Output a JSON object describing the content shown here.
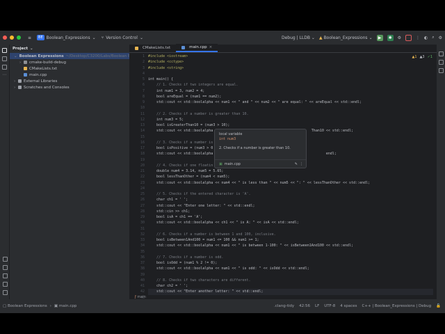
{
  "titlebar": {
    "project_badge": "BE",
    "project_name": "Boolean_Expressions",
    "vcs": "Version Control",
    "config": "Debug | LLDB",
    "run_target": "Boolean_Expressions"
  },
  "project_panel": {
    "title": "Project",
    "items": [
      {
        "label": "Boolean Expressions",
        "hint": "~/Desktop/C3200/Labs/Boolean Expressions",
        "indent": 0,
        "icon": "folder"
      },
      {
        "label": "cmake-build-debug",
        "hint": "",
        "indent": 1,
        "icon": "folder"
      },
      {
        "label": "CMakeLists.txt",
        "hint": "",
        "indent": 1,
        "icon": "cmake"
      },
      {
        "label": "main.cpp",
        "hint": "",
        "indent": 1,
        "icon": "cpp"
      },
      {
        "label": "External Libraries",
        "hint": "",
        "indent": 0,
        "icon": "library"
      },
      {
        "label": "Scratches and Consoles",
        "hint": "",
        "indent": 0,
        "icon": "scratch"
      }
    ]
  },
  "tabs": [
    {
      "label": "CMakeLists.txt",
      "active": false
    },
    {
      "label": "main.cpp",
      "active": true
    }
  ],
  "inspections": {
    "warnings": "1",
    "weak": "3",
    "typos": "1"
  },
  "code": {
    "start_line": 1,
    "lines": [
      {
        "text": "#include <iostream>",
        "kind": "directive"
      },
      {
        "text": "#include <cctype>",
        "kind": "directive"
      },
      {
        "text": "#include <string>",
        "kind": "directive"
      },
      {
        "text": "",
        "kind": ""
      },
      {
        "text": "int main() {",
        "kind": ""
      },
      {
        "text": "    // 1. Checks if two integers are equal.",
        "kind": "comment"
      },
      {
        "text": "    int num1 = 3, num2 = 4;",
        "kind": ""
      },
      {
        "text": "    bool areEqual = (num1 == num2);",
        "kind": ""
      },
      {
        "text": "    std::cout << std::boolalpha << num1 << \" and \" << num2 << \" are equal: \" << areEqual << std::endl;",
        "kind": ""
      },
      {
        "text": "",
        "kind": ""
      },
      {
        "text": "    // 2. Checks if a number is greater than 10.",
        "kind": "comment"
      },
      {
        "text": "    int num3 = 5;",
        "kind": ""
      },
      {
        "text": "    bool isGreaterThan10 = (num3 > 10);",
        "kind": ""
      },
      {
        "text": "    std::cout << std::boolalpha                                               Than10 << std::endl;",
        "kind": ""
      },
      {
        "text": "",
        "kind": ""
      },
      {
        "text": "    // 3. Checks if a number is",
        "kind": "comment"
      },
      {
        "text": "    bool isPositive = (num3 > 0",
        "kind": ""
      },
      {
        "text": "    std::cout << std::boolalpha                                                      endl;",
        "kind": ""
      },
      {
        "text": "",
        "kind": ""
      },
      {
        "text": "    // 4. Checks if one floatin",
        "kind": "comment"
      },
      {
        "text": "    double num4 = 3.14, num5 = 5.65;",
        "kind": ""
      },
      {
        "text": "    bool lessThanOther = (num4 < num5);",
        "kind": ""
      },
      {
        "text": "    std::cout << std::boolalpha << num4 << \" is less than \" << num5 << \": \" << lessThanOther << std::endl;",
        "kind": ""
      },
      {
        "text": "",
        "kind": ""
      },
      {
        "text": "    // 5. Checks if the entered character is 'A'.",
        "kind": "comment"
      },
      {
        "text": "    char ch1 = ' ';",
        "kind": ""
      },
      {
        "text": "    std::cout << \"Enter one letter: \" << std::endl;",
        "kind": ""
      },
      {
        "text": "    std::cin >> ch1;",
        "kind": ""
      },
      {
        "text": "    bool isA = ch1 == 'A';",
        "kind": ""
      },
      {
        "text": "    std::cout << std::boolalpha << ch1 << \" is A: \" << isA << std::endl;",
        "kind": ""
      },
      {
        "text": "",
        "kind": ""
      },
      {
        "text": "    // 6. Checks if a number is between 1 and 100, inclusive.",
        "kind": "comment"
      },
      {
        "text": "    bool isBetween1And100 = num1 <= 100 && num1 >= 1;",
        "kind": ""
      },
      {
        "text": "    std::cout << std::boolalpha << num1 << \" is between 1-100: \" << isBetween1And100 << std::endl;",
        "kind": ""
      },
      {
        "text": "",
        "kind": ""
      },
      {
        "text": "    // 7. Checks if a number is odd.",
        "kind": "comment"
      },
      {
        "text": "    bool isOdd = (num1 % 2 != 0);",
        "kind": ""
      },
      {
        "text": "    std::cout << std::boolalpha << num1 << \" is odd: \" << isOdd << std::endl;",
        "kind": ""
      },
      {
        "text": "",
        "kind": ""
      },
      {
        "text": "    // 8. Checks if two characters are different.",
        "kind": "comment"
      },
      {
        "text": "    char ch2 = ' ';",
        "kind": ""
      },
      {
        "text": "    std::cout << \"Enter another letter: \" << std::endl;",
        "kind": "cur"
      },
      {
        "text": "    std::cin >> ch2;",
        "kind": ""
      }
    ]
  },
  "popup": {
    "title": "local variable",
    "signature": "int num3",
    "doc": "2. Checks if a number is greater than 10.",
    "file": "main.cpp"
  },
  "editor_breadcrumb": "main",
  "statusbar": {
    "breadcrumb_project": "Boolean Expressions",
    "breadcrumb_file": "main.cpp",
    "tool": ".clang-tidy",
    "position": "42:56",
    "line_sep": "LF",
    "encoding": "UTF-8",
    "indent": "4 spaces",
    "context": "C++ | Boolean_Expressions | Debug"
  },
  "colors": {
    "accent": "#3574f0",
    "run_green": "#57965c",
    "stop_red": "#db5c5c"
  }
}
